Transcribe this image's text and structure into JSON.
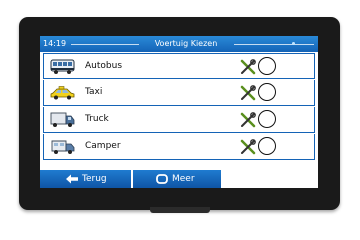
{
  "header": {
    "time": "14:19",
    "title": "Voertuig Kiezen"
  },
  "vehicles": [
    {
      "label": "Autobus",
      "icon": "bus-icon"
    },
    {
      "label": "Taxi",
      "icon": "taxi-icon"
    },
    {
      "label": "Truck",
      "icon": "truck-icon"
    },
    {
      "label": "Camper",
      "icon": "camper-icon"
    }
  ],
  "footer": {
    "back_label": "Terug",
    "more_label": "Meer"
  },
  "colors": {
    "accent": "#1463b6",
    "device": "#1a1a1a"
  }
}
